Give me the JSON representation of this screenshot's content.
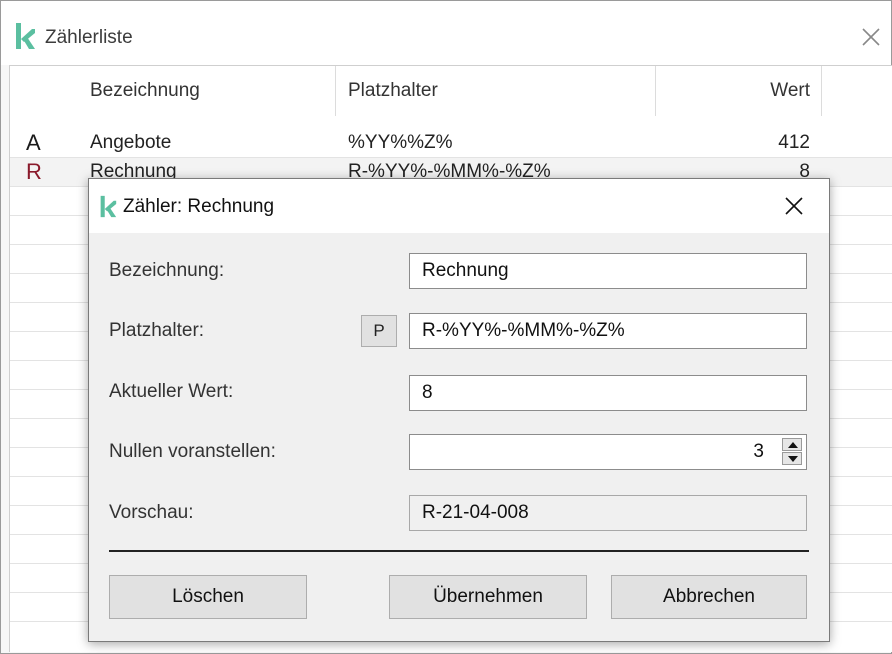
{
  "window": {
    "title": "Zählerliste",
    "close_icon": "close-icon"
  },
  "table": {
    "columns": {
      "name": "Bezeichnung",
      "placeholder": "Platzhalter",
      "value": "Wert"
    },
    "rows": [
      {
        "letter": "A",
        "letter_color": "#111111",
        "name": "Angebote",
        "placeholder": "%YY%%Z%",
        "value": "412"
      },
      {
        "letter": "R",
        "letter_color": "#8a1a2b",
        "name": "Rechnung",
        "placeholder": "R-%YY%-%MM%-%Z%",
        "value": "8"
      }
    ]
  },
  "dialog": {
    "title": "Zähler: Rechnung",
    "labels": {
      "name": "Bezeichnung:",
      "placeholder": "Platzhalter:",
      "current_value": "Aktueller Wert:",
      "leading_zeros": "Nullen voranstellen:",
      "preview": "Vorschau:"
    },
    "placeholder_button": "P",
    "values": {
      "name": "Rechnung",
      "placeholder": "R-%YY%-%MM%-%Z%",
      "current_value": "8",
      "leading_zeros": "3",
      "preview": "R-21-04-008"
    },
    "buttons": {
      "delete": "Löschen",
      "apply": "Übernehmen",
      "cancel": "Abbrechen"
    }
  },
  "colors": {
    "brand": "#5bbfa0",
    "selected_row": "#f3f3f3",
    "dialog_bg": "#f0f0f0"
  }
}
